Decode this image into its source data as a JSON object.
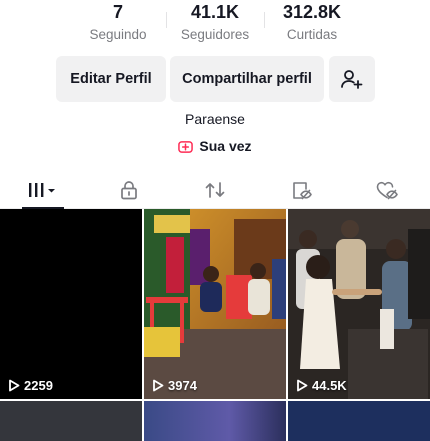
{
  "stats": [
    {
      "value": "7",
      "label": "Seguindo"
    },
    {
      "value": "41.1K",
      "label": "Seguidores"
    },
    {
      "value": "312.8K",
      "label": "Curtidas"
    }
  ],
  "buttons": {
    "edit": "Editar Perfil",
    "share": "Compartilhar perfil"
  },
  "bio": "Paraense",
  "link": "Sua vez",
  "tabs": [
    "videos",
    "private",
    "reposts",
    "favorites",
    "liked"
  ],
  "videos": [
    {
      "views": "2259"
    },
    {
      "views": "3974"
    },
    {
      "views": "44.5K"
    }
  ],
  "colors": {
    "accent": "#fe2c55",
    "text": "#161823",
    "muted": "#7a7b80"
  }
}
